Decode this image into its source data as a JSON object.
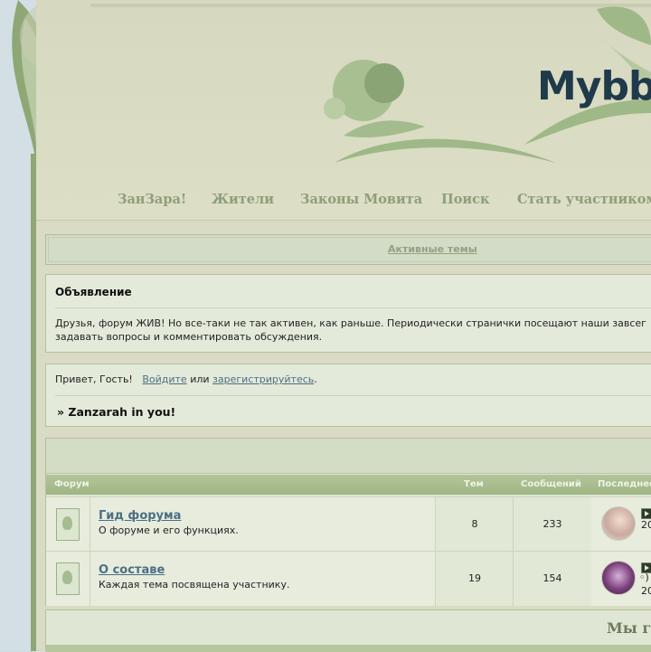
{
  "header": {
    "logo": "Mybb"
  },
  "nav": {
    "items": [
      "ЗанЗара!",
      "Жители",
      "Законы Мовита",
      "Поиск",
      "Стать участником"
    ]
  },
  "active_topics": {
    "label": "Активные темы"
  },
  "announcement": {
    "title": "Объявление",
    "text": "Друзья, форум ЖИВ! Но все-таки не так активен, как раньше. Периодически странички посещают наши завсег задавать вопросы и комментировать обсуждения."
  },
  "greeting": {
    "prefix": "Привет, Гость!",
    "login": "Войдите",
    "or": "или",
    "register": "зарегистрируйтесь",
    "period": ".",
    "section_title": "» Zanzarah in you!"
  },
  "forum_table": {
    "headers": {
      "forum": "Форум",
      "topics": "Тем",
      "posts": "Сообщений",
      "last": "Последнее"
    },
    "rows": [
      {
        "title": "Гид форума",
        "desc": "О форуме и его функциях.",
        "topics": "8",
        "posts": "233",
        "last_line": "20"
      },
      {
        "title": "О составе",
        "desc": "Каждая тема посвящена участнику.",
        "topics": "19",
        "posts": "154",
        "last_extra": "◦)",
        "last_line": "20"
      }
    ]
  },
  "bottom": {
    "title": "Мы г"
  },
  "colors": {
    "accent": "#8fa775",
    "link": "#4b6f84",
    "header_bg": "#d6d8bf"
  }
}
